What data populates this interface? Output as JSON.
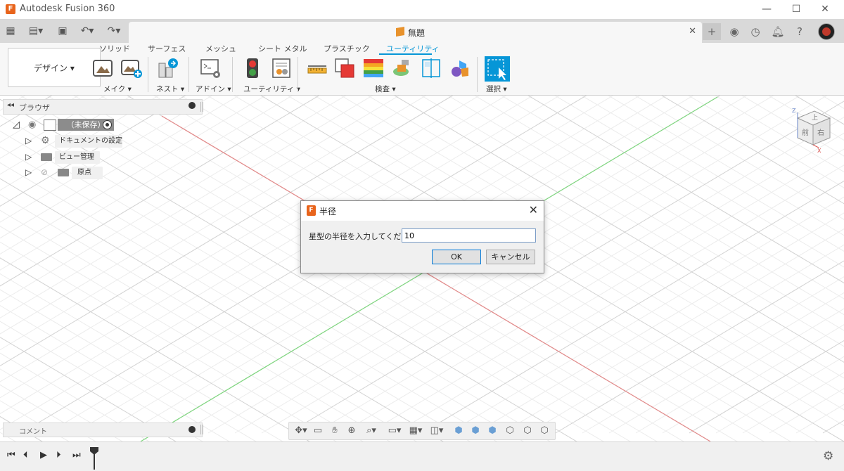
{
  "window": {
    "title": "Autodesk Fusion 360"
  },
  "document": {
    "title": "無題"
  },
  "workspace": {
    "label": "デザイン ▾"
  },
  "ribbon": {
    "tabs": [
      "ソリッド",
      "サーフェス",
      "メッシュ",
      "シート メタル",
      "プラスチック",
      "ユーティリティ"
    ],
    "active_tab": "ユーティリティ",
    "groups": {
      "make": "メイク ▾",
      "nest": "ネスト ▾",
      "addins": "アドイン ▾",
      "utility": "ユーティリティ ▾",
      "inspect": "検査 ▾",
      "select": "選択 ▾"
    }
  },
  "browser": {
    "title": "ブラウザ",
    "root": "（未保存）",
    "items": [
      "ドキュメントの設定",
      "ビュー管理",
      "原点"
    ]
  },
  "viewcube": {
    "top": "上",
    "front": "前",
    "right": "右",
    "axis_z": "Z",
    "axis_x": "X"
  },
  "dialog": {
    "title": "半径",
    "prompt": "星型の半径を入力してください:",
    "value": "10",
    "ok_label": "OK",
    "cancel_label": "キャンセル"
  },
  "comment": {
    "label": "コメント"
  },
  "colors": {
    "accent": "#0696d7",
    "brand": "#e8641c",
    "x_axis": "#e06666",
    "y_axis": "#6fcf6f"
  }
}
